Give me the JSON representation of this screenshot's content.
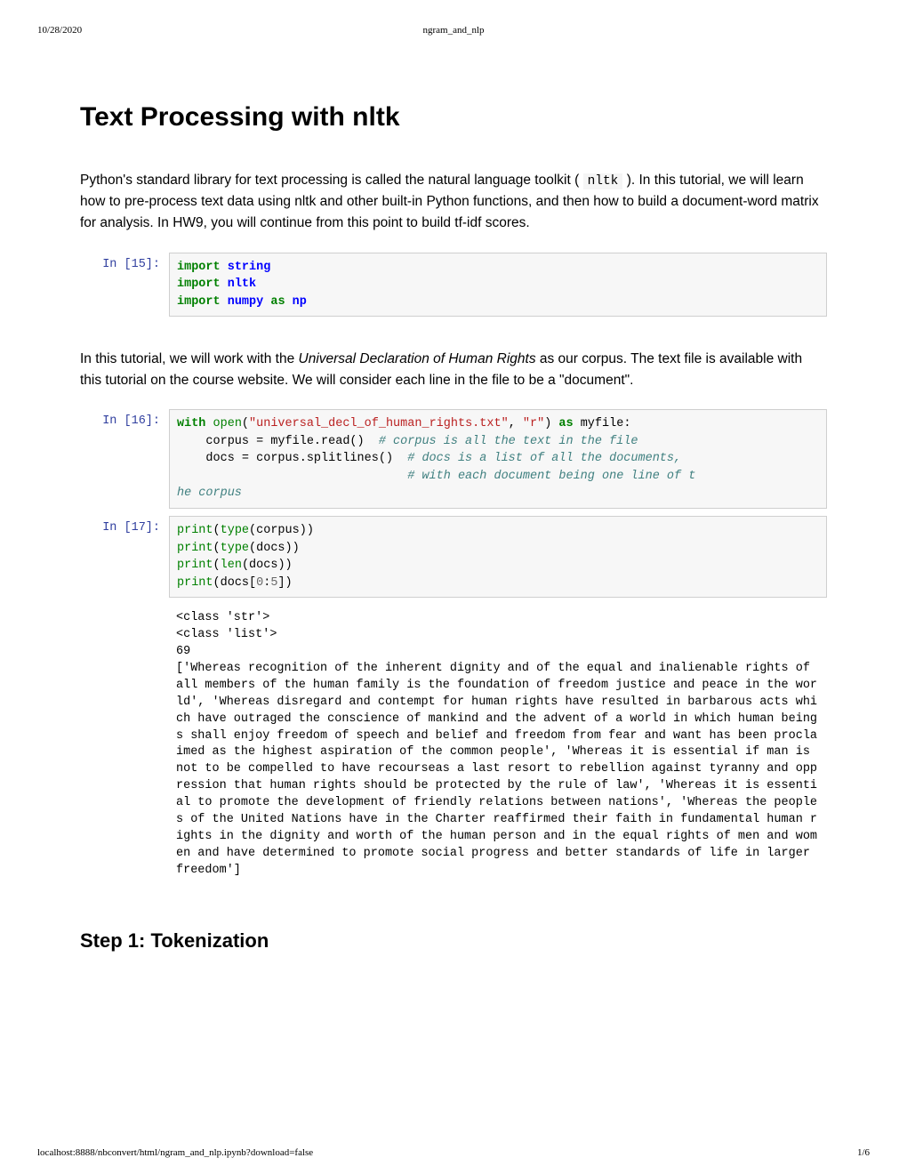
{
  "header": {
    "date": "10/28/2020",
    "doc_title": "ngram_and_nlp"
  },
  "title": "Text Processing with nltk",
  "intro": {
    "p1_a": "Python's standard library for text processing is called the natural language toolkit ( ",
    "p1_code": "nltk",
    "p1_b": " ). In this tutorial, we will learn how to pre-process text data using nltk and other built-in Python functions, and then how to build a document-word matrix for analysis. In HW9, you will continue from this point to build tf-idf scores."
  },
  "cell15": {
    "prompt": "In [15]:",
    "import": "import",
    "as": "as",
    "m1": "string",
    "m2": "nltk",
    "m3": "numpy",
    "alias": "np"
  },
  "para2": {
    "a": "In this tutorial, we will work with the ",
    "i": "Universal Declaration of Human Rights",
    "b": " as our corpus. The text file is available with this tutorial on the course website. We will consider each line in the file to be a \"document\"."
  },
  "cell16": {
    "prompt": "In [16]:",
    "with": "with",
    "open": "open",
    "fname": "\"universal_decl_of_human_rights.txt\"",
    "mode": "\"r\"",
    "as": "as",
    "l1b": " myfile:",
    "l2a": "    corpus = myfile.read()  ",
    "c1": "# corpus is all the text in the file",
    "l3a": "    docs = corpus.splitlines()  ",
    "c2": "# docs is a list of all the documents,",
    "l4pad": "                                ",
    "c3": "# with each document being one line of t",
    "c3b": "he corpus"
  },
  "cell17": {
    "prompt": "In [17]:",
    "print": "print",
    "type": "type",
    "len": "len",
    "l1b": "(corpus))",
    "l2b": "(docs))",
    "l3b": "(docs))",
    "l4a": "(docs[",
    "n0": "0",
    "colon": ":",
    "n5": "5",
    "l4b": "])"
  },
  "output17": "<class 'str'>\n<class 'list'>\n69\n['Whereas recognition of the inherent dignity and of the equal and inalienable rights of all members of the human family is the foundation of freedom justice and peace in the world', 'Whereas disregard and contempt for human rights have resulted in barbarous acts which have outraged the conscience of mankind and the advent of a world in which human beings shall enjoy freedom of speech and belief and freedom from fear and want has been proclaimed as the highest aspiration of the common people', 'Whereas it is essential if man is not to be compelled to have recourseas a last resort to rebellion against tyranny and oppression that human rights should be protected by the rule of law', 'Whereas it is essential to promote the development of friendly relations between nations', 'Whereas the peoples of the United Nations have in the Charter reaffirmed their faith in fundamental human rights in the dignity and worth of the human person and in the equal rights of men and women and have determined to promote social progress and better standards of life in larger freedom']",
  "step1": "Step 1: Tokenization",
  "footer": {
    "url": "localhost:8888/nbconvert/html/ngram_and_nlp.ipynb?download=false",
    "page": "1/6"
  }
}
